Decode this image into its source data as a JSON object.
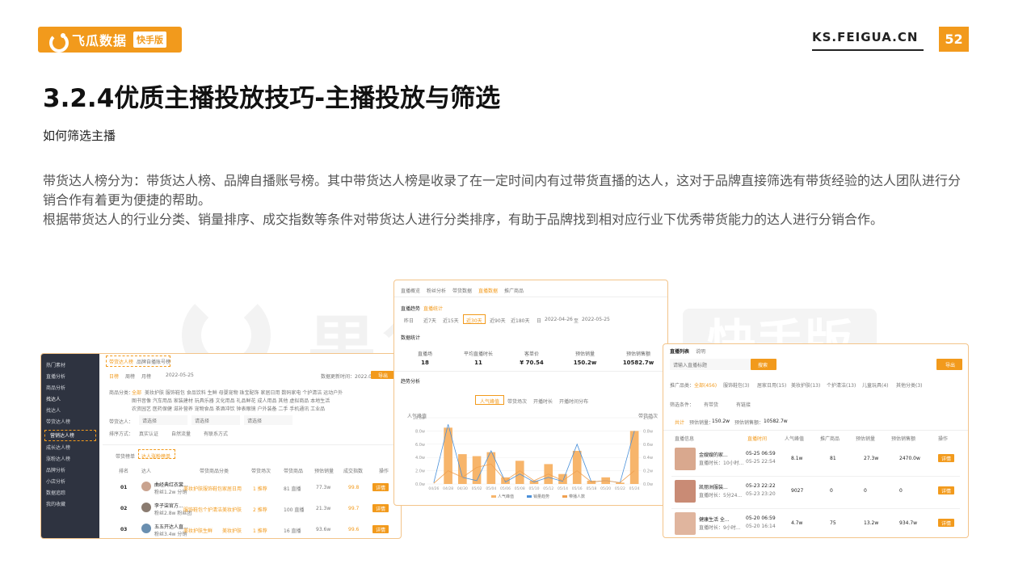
{
  "header": {
    "brand_name": "飞瓜数据",
    "brand_badge": "快手版",
    "site_url": "KS.FEIGUA.CN",
    "page_number": "52"
  },
  "slide": {
    "title": "3.2.4优质主播投放技巧-主播投放与筛选",
    "subtitle": "如何筛选主播",
    "paragraphs": [
      "带货达人榜分为：带货达人榜、品牌自播账号榜。其中带货达人榜是收录了在一定时间内有过带货直播的达人，这对于品牌直接筛选有带货经验的达人团队进行分销合作有着更为便捷的帮助。",
      "根据带货达人的行业分类、销量排序、成交指数等条件对带货达人进行分类排序，有助于品牌找到相对应行业下优秀带货能力的达人进行分销合作。"
    ]
  },
  "watermark": {
    "text": "果集·飞瓜",
    "badge": "快手版"
  },
  "screenshot1": {
    "sidebar": [
      "热门素材",
      "直播分析",
      "商品分析",
      "找达人",
      "找达人",
      "带货达人榜",
      "营销达人榜",
      "成长达人榜",
      "涨粉达人榜",
      "品牌分析",
      "小店分析",
      "数据追踪",
      "我的收藏"
    ],
    "tabs": [
      "带货达人榜",
      "品牌自播账号榜"
    ],
    "period_tabs": [
      "日榜",
      "周榜",
      "月榜"
    ],
    "date": "2022-05-25",
    "update_note": "数据更新时间：2022.05.26",
    "export_label": "导出",
    "filter_label": "商品分类：",
    "filter_first": "全部",
    "category_rows": [
      "美妆护肤  服饰鞋包  食品饮料  生鲜  母婴宠物  珠宝配饰  家居日用  数码家电  个护清洁  运动户外",
      "图书音像  汽车用品  家装建材  玩具乐器  文化用品  礼品鲜花  成人用品  其他  虚拟商品  本地生活",
      "农资园艺  医药保健  滋补营养  宠物食品  茶酒冲饮  钟表眼镜  户外装备  二手  手机通讯  工业品"
    ],
    "selects": [
      "请选择",
      "请选择",
      "请选择"
    ],
    "row_filter_labels": [
      "带货达人：",
      "排序方式："
    ],
    "checks": [
      "真实认证",
      "自然流量",
      "有联系方式"
    ],
    "list_tabs": [
      "带货榜单",
      "达人涨粉榜单"
    ],
    "columns": [
      "排名",
      "达人",
      "带货商品分类",
      "带货场次",
      "带货商品",
      "预估销量",
      "成交指数",
      "操作"
    ],
    "rows": [
      {
        "rank": "01",
        "name": "曲经典红衣裳...",
        "sub": "粉丝1.2w 分销",
        "tags": [
          "美妆护肤",
          "服饰鞋包",
          "家居日用"
        ],
        "sessions": "1 推荐",
        "goods": "81 直播",
        "sales": "77.3w",
        "index": "99.8",
        "op": "详情"
      },
      {
        "rank": "02",
        "name": "李子柒官方...",
        "sub": "粉丝2.8w 粉丝团",
        "tags": [
          "服饰鞋包",
          "个护清洁",
          "美妆护肤"
        ],
        "sessions": "2 推荐",
        "goods": "100 直播",
        "sales": "21.3w",
        "index": "99.7",
        "op": "详情"
      },
      {
        "rank": "03",
        "name": "五五开达人直...",
        "sub": "粉丝3.4w 分销",
        "tags": [
          "美妆护肤",
          "生鲜",
          "美妆护肤"
        ],
        "sessions": "1 推荐",
        "goods": "16 直播",
        "sales": "93.6w",
        "index": "99.6",
        "op": "详情"
      }
    ]
  },
  "screenshot2": {
    "tabs": [
      "直播概览",
      "粉丝分析",
      "带货数据",
      "直播数据",
      "推广商品"
    ],
    "active_tab": "直播数据",
    "section1_label": "直播趋势",
    "section1_tag": "直播统计",
    "ranges": [
      "昨日",
      "近7天",
      "近15天",
      "近30天",
      "近90天",
      "近180天"
    ],
    "active_range": "近30天",
    "date_from": "2022-04-26",
    "date_to": "2022-05-25",
    "date_sep": "至",
    "date_label": "日",
    "section2_label": "数据统计",
    "kpis": [
      {
        "label": "直播场",
        "value": "18"
      },
      {
        "label": "平均直播时长",
        "value": "11"
      },
      {
        "label": "客单价",
        "value": "¥ 70.54"
      },
      {
        "label": "预估销量",
        "value": "150.2w"
      },
      {
        "label": "预估销售额",
        "value": "10582.7w"
      }
    ],
    "trend_label": "趋势分析",
    "chart_tabs": [
      "人气峰值",
      "带货场次",
      "开播时长",
      "开播时间分布"
    ]
  },
  "chart_data": {
    "type": "bar",
    "categories": [
      "04/26",
      "04/28",
      "04/30",
      "05/02",
      "05/04",
      "05/06",
      "05/08",
      "05/10",
      "05/12",
      "05/14",
      "05/16",
      "05/18",
      "05/20",
      "05/22",
      "05/24"
    ],
    "series": [
      {
        "name": "人气峰值",
        "values": [
          0,
          8.5,
          4.5,
          4.2,
          4.8,
          1.0,
          3.5,
          0.5,
          3.0,
          1.5,
          5.0,
          0.5,
          1.0,
          0.2,
          8.0
        ]
      },
      {
        "name": "销量趋势",
        "values": [
          0.2,
          9.0,
          1.0,
          0.5,
          5.0,
          0.3,
          1.5,
          0.3,
          1.0,
          0.4,
          6.0,
          0.3,
          0.5,
          0.2,
          8.0
        ]
      },
      {
        "name": "带播人数",
        "values": [
          0.1,
          2.0,
          1.0,
          2.5,
          3.0,
          0.5,
          2.0,
          0.5,
          1.5,
          0.5,
          2.0,
          0.3,
          0.5,
          0.2,
          2.0
        ]
      }
    ],
    "ylabel": "人气峰值",
    "ylabel_right": "带货场次",
    "ylim": [
      0,
      10
    ],
    "y_ticks": [
      "10.0w",
      "8.0w",
      "6.0w",
      "4.0w",
      "2.0w",
      "0.0w"
    ],
    "y_ticks_right": [
      "1.0w",
      "0.8w",
      "0.6w",
      "0.4w",
      "0.2w",
      "0.0w"
    ],
    "legend": "bottom",
    "grid": true
  },
  "screenshot3": {
    "header": "直播列表",
    "header_note": "说明",
    "search_placeholder": "请输入直播标题",
    "search_button": "搜索",
    "export_button": "导出",
    "category_label": "推广品类：",
    "categories": [
      "全部(456)",
      "服饰鞋包(3)",
      "居家日用(15)",
      "美妆护肤(13)",
      "个护清洁(13)",
      "儿童玩具(4)",
      "其他分类(3)"
    ],
    "filter_label": "筛选条件：",
    "filters": [
      "有带货",
      "有链接"
    ],
    "summary": [
      "共计",
      "预估销量：",
      "150.2w",
      "预估销售额：",
      "10582.7w"
    ],
    "columns": [
      "直播信息",
      "直播时间",
      "人气峰值",
      "推广商品",
      "预估销量",
      "预估销售额",
      "操作"
    ],
    "rows": [
      {
        "title": "金嫂嫂的家...",
        "sub": "直播时长：10小时...",
        "start": "05-25 06:59",
        "end": "05-25 22:54",
        "peak": "8.1w",
        "goods": "81",
        "sales": "27.3w",
        "revenue": "2470.0w",
        "op": "详情"
      },
      {
        "title": "凯丽洲服装...",
        "sub": "直播时长：5分24...",
        "start": "05-23 22:22",
        "end": "05-23 23:20",
        "peak": "9027",
        "goods": "0",
        "sales": "0",
        "revenue": "0",
        "op": "详情"
      },
      {
        "title": "健康生活 全...",
        "sub": "直播时长：9小时...",
        "start": "05-20 06:59",
        "end": "05-20 16:14",
        "peak": "4.7w",
        "goods": "75",
        "sales": "13.2w",
        "revenue": "934.7w",
        "op": "详情"
      }
    ]
  }
}
